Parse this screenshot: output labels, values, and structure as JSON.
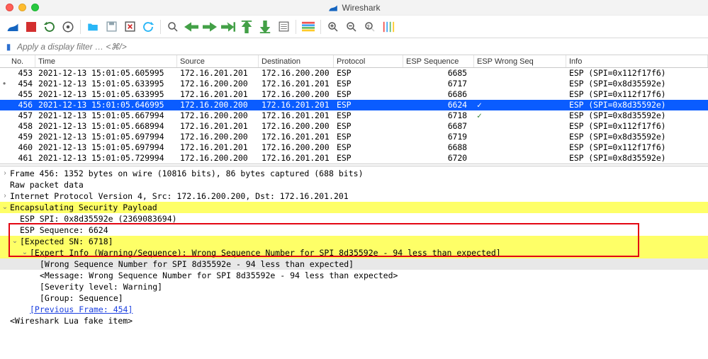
{
  "app": {
    "title": "Wireshark"
  },
  "filter": {
    "placeholder": "Apply a display filter … <⌘/>"
  },
  "columns": {
    "no": "No.",
    "time": "Time",
    "src": "Source",
    "dst": "Destination",
    "proto": "Protocol",
    "seq": "ESP Sequence",
    "wrong": "ESP Wrong Seq",
    "info": "Info"
  },
  "packets": [
    {
      "no": "453",
      "time": "2021-12-13 15:01:05.605995",
      "src": "172.16.201.201",
      "dst": "172.16.200.200",
      "proto": "ESP",
      "seq": "6685",
      "wrong": "",
      "info": "ESP (SPI=0x112f17f6)",
      "selected": false,
      "marker": ""
    },
    {
      "no": "454",
      "time": "2021-12-13 15:01:05.633995",
      "src": "172.16.200.200",
      "dst": "172.16.201.201",
      "proto": "ESP",
      "seq": "6717",
      "wrong": "",
      "info": "ESP (SPI=0x8d35592e)",
      "selected": false,
      "marker": "•"
    },
    {
      "no": "455",
      "time": "2021-12-13 15:01:05.633995",
      "src": "172.16.201.201",
      "dst": "172.16.200.200",
      "proto": "ESP",
      "seq": "6686",
      "wrong": "",
      "info": "ESP (SPI=0x112f17f6)",
      "selected": false,
      "marker": ""
    },
    {
      "no": "456",
      "time": "2021-12-13 15:01:05.646995",
      "src": "172.16.200.200",
      "dst": "172.16.201.201",
      "proto": "ESP",
      "seq": "6624",
      "wrong": "✓",
      "info": "ESP (SPI=0x8d35592e)",
      "selected": true,
      "marker": ""
    },
    {
      "no": "457",
      "time": "2021-12-13 15:01:05.667994",
      "src": "172.16.200.200",
      "dst": "172.16.201.201",
      "proto": "ESP",
      "seq": "6718",
      "wrong": "✓",
      "info": "ESP (SPI=0x8d35592e)",
      "selected": false,
      "marker": ""
    },
    {
      "no": "458",
      "time": "2021-12-13 15:01:05.668994",
      "src": "172.16.201.201",
      "dst": "172.16.200.200",
      "proto": "ESP",
      "seq": "6687",
      "wrong": "",
      "info": "ESP (SPI=0x112f17f6)",
      "selected": false,
      "marker": ""
    },
    {
      "no": "459",
      "time": "2021-12-13 15:01:05.697994",
      "src": "172.16.200.200",
      "dst": "172.16.201.201",
      "proto": "ESP",
      "seq": "6719",
      "wrong": "",
      "info": "ESP (SPI=0x8d35592e)",
      "selected": false,
      "marker": ""
    },
    {
      "no": "460",
      "time": "2021-12-13 15:01:05.697994",
      "src": "172.16.201.201",
      "dst": "172.16.200.200",
      "proto": "ESP",
      "seq": "6688",
      "wrong": "",
      "info": "ESP (SPI=0x112f17f6)",
      "selected": false,
      "marker": ""
    },
    {
      "no": "461",
      "time": "2021-12-13 15:01:05.729994",
      "src": "172.16.200.200",
      "dst": "172.16.201.201",
      "proto": "ESP",
      "seq": "6720",
      "wrong": "",
      "info": "ESP (SPI=0x8d35592e)",
      "selected": false,
      "marker": ""
    }
  ],
  "details": {
    "frame": "Frame 456: 1352 bytes on wire (10816 bits), 86 bytes captured (688 bits)",
    "raw": "Raw packet data",
    "ip": "Internet Protocol Version 4, Src: 172.16.200.200, Dst: 172.16.201.201",
    "esp": "Encapsulating Security Payload",
    "spi": "ESP SPI: 0x8d35592e (2369083694)",
    "seq": "ESP Sequence: 6624",
    "expect": "[Expected SN: 6718]",
    "expert": "[Expert Info (Warning/Sequence): Wrong Sequence Number for SPI 8d35592e - 94 less than expected]",
    "wrong": "[Wrong Sequence Number for SPI 8d35592e - 94 less than expected]",
    "msg": "<Message: Wrong Sequence Number for SPI 8d35592e - 94 less than expected>",
    "sev": "[Severity level: Warning]",
    "grp": "[Group: Sequence]",
    "prev": "[Previous Frame: 454]",
    "lua": "<Wireshark Lua fake item>"
  }
}
